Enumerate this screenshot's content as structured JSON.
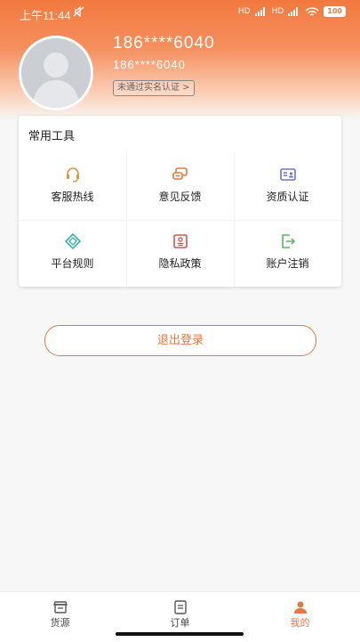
{
  "status_bar": {
    "time": "上午11:44",
    "mute_icon": "mute-icon",
    "signal": "HD",
    "battery": "100"
  },
  "profile": {
    "avatar_icon": "default-avatar-icon",
    "name": "186****6040",
    "phone": "186****6040",
    "auth_status": "未通过实名认证 >"
  },
  "tools": {
    "title": "常用工具",
    "items": [
      {
        "label": "客服热线",
        "icon": "headset-icon",
        "color": "#e8923c"
      },
      {
        "label": "意见反馈",
        "icon": "chat-bubbles-icon",
        "color": "#e07a3a"
      },
      {
        "label": "资质认证",
        "icon": "id-card-icon",
        "color": "#6b74c9"
      },
      {
        "label": "平台规则",
        "icon": "diamond-icon",
        "color": "#3bb3a6"
      },
      {
        "label": "隐私政策",
        "icon": "privacy-doc-icon",
        "color": "#d9534f"
      },
      {
        "label": "账户注销",
        "icon": "logout-arrow-icon",
        "color": "#5cb85c"
      }
    ]
  },
  "logout_button": "退出登录",
  "tabbar": {
    "items": [
      {
        "label": "货源",
        "icon": "store-icon"
      },
      {
        "label": "订单",
        "icon": "order-icon"
      },
      {
        "label": "我的",
        "icon": "person-icon"
      }
    ],
    "active_color": "#e47845"
  },
  "colors": {
    "accent": "#f2793f",
    "button": "#e47845"
  }
}
